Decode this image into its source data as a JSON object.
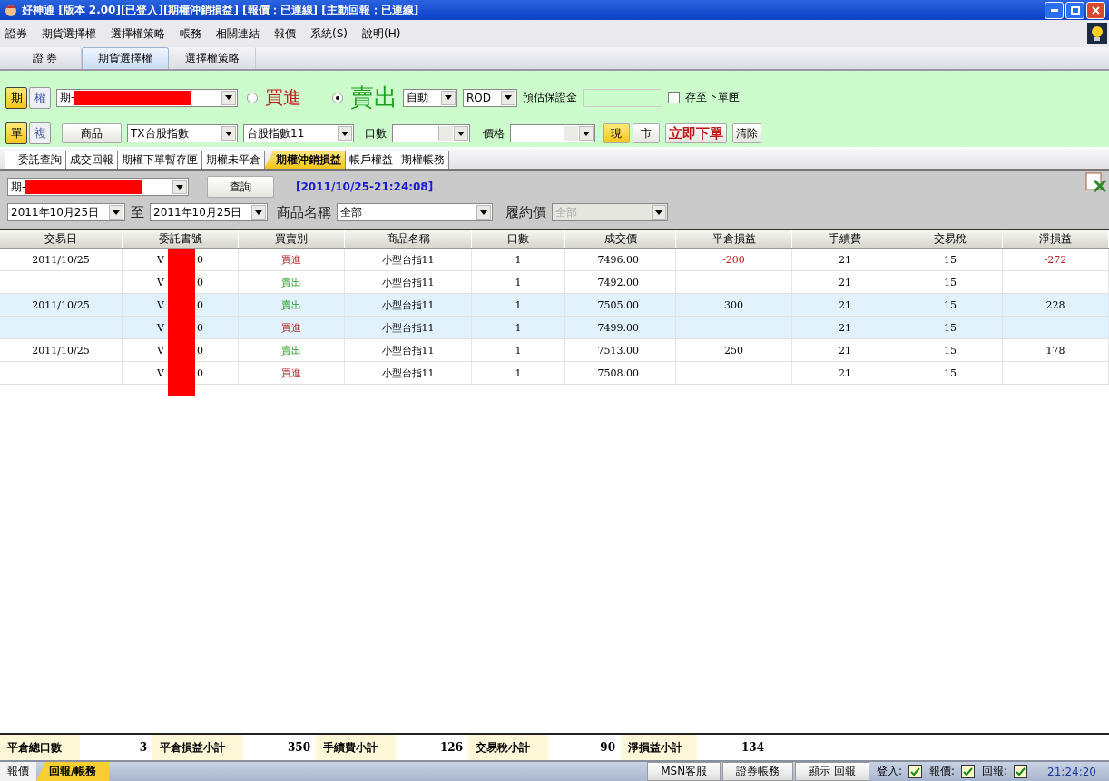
{
  "window": {
    "title": "好神通 [版本 2.00][已登入][期權沖銷損益] [報價：已連線] [主動回報：已連線]"
  },
  "menu": [
    "證券",
    "期貨選擇權",
    "選擇權策略",
    "帳務",
    "相關連結",
    "報價",
    "系統(S)",
    "說明(H)"
  ],
  "main_tabs": [
    {
      "label": "證 券",
      "selected": false
    },
    {
      "label": "期貨選擇權",
      "selected": true
    },
    {
      "label": "選擇權策略",
      "selected": false
    }
  ],
  "order_panel": {
    "market_toggle": [
      {
        "label": "期",
        "selected": true
      },
      {
        "label": "權",
        "selected": false
      }
    ],
    "mode_toggle": [
      {
        "label": "單",
        "selected": true
      },
      {
        "label": "複",
        "selected": false
      }
    ],
    "account": "期-",
    "side": [
      {
        "label": "買進",
        "kind": "buy",
        "selected": false
      },
      {
        "label": "賣出",
        "kind": "sell",
        "selected": true
      }
    ],
    "condition": "自動",
    "order_type": "ROD",
    "margin_label": "預估保證金",
    "save_checkbox": {
      "label": "存至下單匣",
      "checked": false
    },
    "product_button": "商品",
    "product": "TX台股指數",
    "contract": "台股指數11",
    "qty_label": "口數",
    "price_label": "價格",
    "price_type": [
      {
        "label": "現",
        "selected": true
      },
      {
        "label": "市",
        "selected": false
      }
    ],
    "submit": "立即下單",
    "clear": "清除"
  },
  "sub_tabs": [
    {
      "label": "委託查詢",
      "selected": false
    },
    {
      "label": "成交回報",
      "selected": false
    },
    {
      "label": "期權下單暫存匣",
      "selected": false
    },
    {
      "label": "期權未平倉",
      "selected": false
    },
    {
      "label": "期權沖銷損益",
      "selected": true
    },
    {
      "label": "帳戶權益",
      "selected": false
    },
    {
      "label": "期權帳務",
      "selected": false
    }
  ],
  "query": {
    "account": "期-",
    "query_button": "查詢",
    "timestamp": "[2011/10/25-21:24:08]",
    "date_from": "2011年10月25日",
    "to_label": "至",
    "date_to": "2011年10月25日",
    "product_label": "商品名稱",
    "product": "全部",
    "strike_label": "履約價",
    "strike": {
      "value": "全部",
      "disabled": true
    }
  },
  "table": {
    "columns": [
      "交易日",
      "委託書號",
      "買賣別",
      "商品名稱",
      "口數",
      "成交價",
      "平倉損益",
      "手續費",
      "交易稅",
      "淨損益"
    ],
    "rows": [
      {
        "selected": false,
        "date": "2011/10/25",
        "order_prefix": "V",
        "order_suffix": "0",
        "side": {
          "label": "買進",
          "kind": "buy"
        },
        "product": "小型台指11",
        "qty": "1",
        "price": "7496.00",
        "pnl": "-200",
        "fee": "21",
        "tax": "15",
        "net": "-272",
        "loss": true
      },
      {
        "selected": false,
        "order_prefix": "V",
        "order_suffix": "0",
        "side": {
          "label": "賣出",
          "kind": "sell"
        },
        "product": "小型台指11",
        "qty": "1",
        "price": "7492.00",
        "fee": "21",
        "tax": "15"
      },
      {
        "selected": true,
        "date": "2011/10/25",
        "order_prefix": "V",
        "order_suffix": "0",
        "side": {
          "label": "賣出",
          "kind": "sell"
        },
        "product": "小型台指11",
        "qty": "1",
        "price": "7505.00",
        "pnl": "300",
        "fee": "21",
        "tax": "15",
        "net": "228",
        "loss": false
      },
      {
        "selected": true,
        "order_prefix": "V",
        "order_suffix": "0",
        "side": {
          "label": "買進",
          "kind": "buy"
        },
        "product": "小型台指11",
        "qty": "1",
        "price": "7499.00",
        "fee": "21",
        "tax": "15"
      },
      {
        "selected": false,
        "date": "2011/10/25",
        "order_prefix": "V",
        "order_suffix": "0",
        "side": {
          "label": "賣出",
          "kind": "sell"
        },
        "product": "小型台指11",
        "qty": "1",
        "price": "7513.00",
        "pnl": "250",
        "fee": "21",
        "tax": "15",
        "net": "178",
        "loss": false
      },
      {
        "selected": false,
        "order_prefix": "V",
        "order_suffix": "0",
        "side": {
          "label": "買進",
          "kind": "buy"
        },
        "product": "小型台指11",
        "qty": "1",
        "price": "7508.00",
        "fee": "21",
        "tax": "15"
      }
    ]
  },
  "summary": [
    {
      "label": "平倉總口數",
      "value": "3"
    },
    {
      "label": "平倉損益小計",
      "value": "350"
    },
    {
      "label": "手續費小計",
      "value": "126"
    },
    {
      "label": "交易稅小計",
      "value": "90"
    },
    {
      "label": "淨損益小計",
      "value": "134"
    }
  ],
  "status_bar": {
    "tabs": [
      {
        "label": "報價",
        "selected": false
      },
      {
        "label": "回報/帳務",
        "selected": true
      }
    ],
    "buttons": [
      "MSN客服",
      "證券帳務",
      "顯示 回報"
    ],
    "indicators": [
      {
        "label": "登入:",
        "checked": true
      },
      {
        "label": "報價:",
        "checked": true
      },
      {
        "label": "回報:",
        "checked": true
      }
    ],
    "clock": "21:24:20"
  }
}
